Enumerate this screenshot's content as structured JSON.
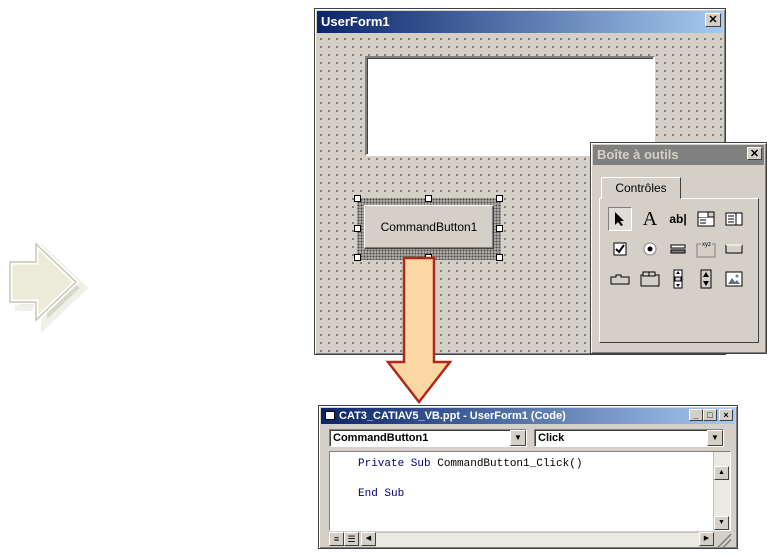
{
  "userform": {
    "title": "UserForm1",
    "close_symbol": "✕",
    "command_button_label": "CommandButton1"
  },
  "toolbox": {
    "title": "Boîte à outils",
    "close_symbol": "✕",
    "tab_label": "Contrôles",
    "tools": [
      "pointer-icon",
      "label-icon",
      "textbox-icon",
      "combobox-icon",
      "listbox-icon",
      "checkbox-icon",
      "optionbutton-icon",
      "togglebutton-icon",
      "frame-icon",
      "commandbutton-icon",
      "tabstrip-icon",
      "multipage-icon",
      "scrollbar-icon",
      "spinbutton-icon",
      "image-icon"
    ],
    "label_glyph": "A",
    "textbox_glyph": "ab|",
    "frame_glyph": "xyz"
  },
  "code_window": {
    "title": "CAT3_CATIAV5_VB.ppt - UserForm1 (Code)",
    "minimize_symbol": "_",
    "maximize_symbol": "□",
    "close_symbol": "×",
    "object_combo_value": "CommandButton1",
    "procedure_combo_value": "Click",
    "code_lines": [
      "Private Sub CommandButton1_Click()",
      "End Sub"
    ]
  }
}
